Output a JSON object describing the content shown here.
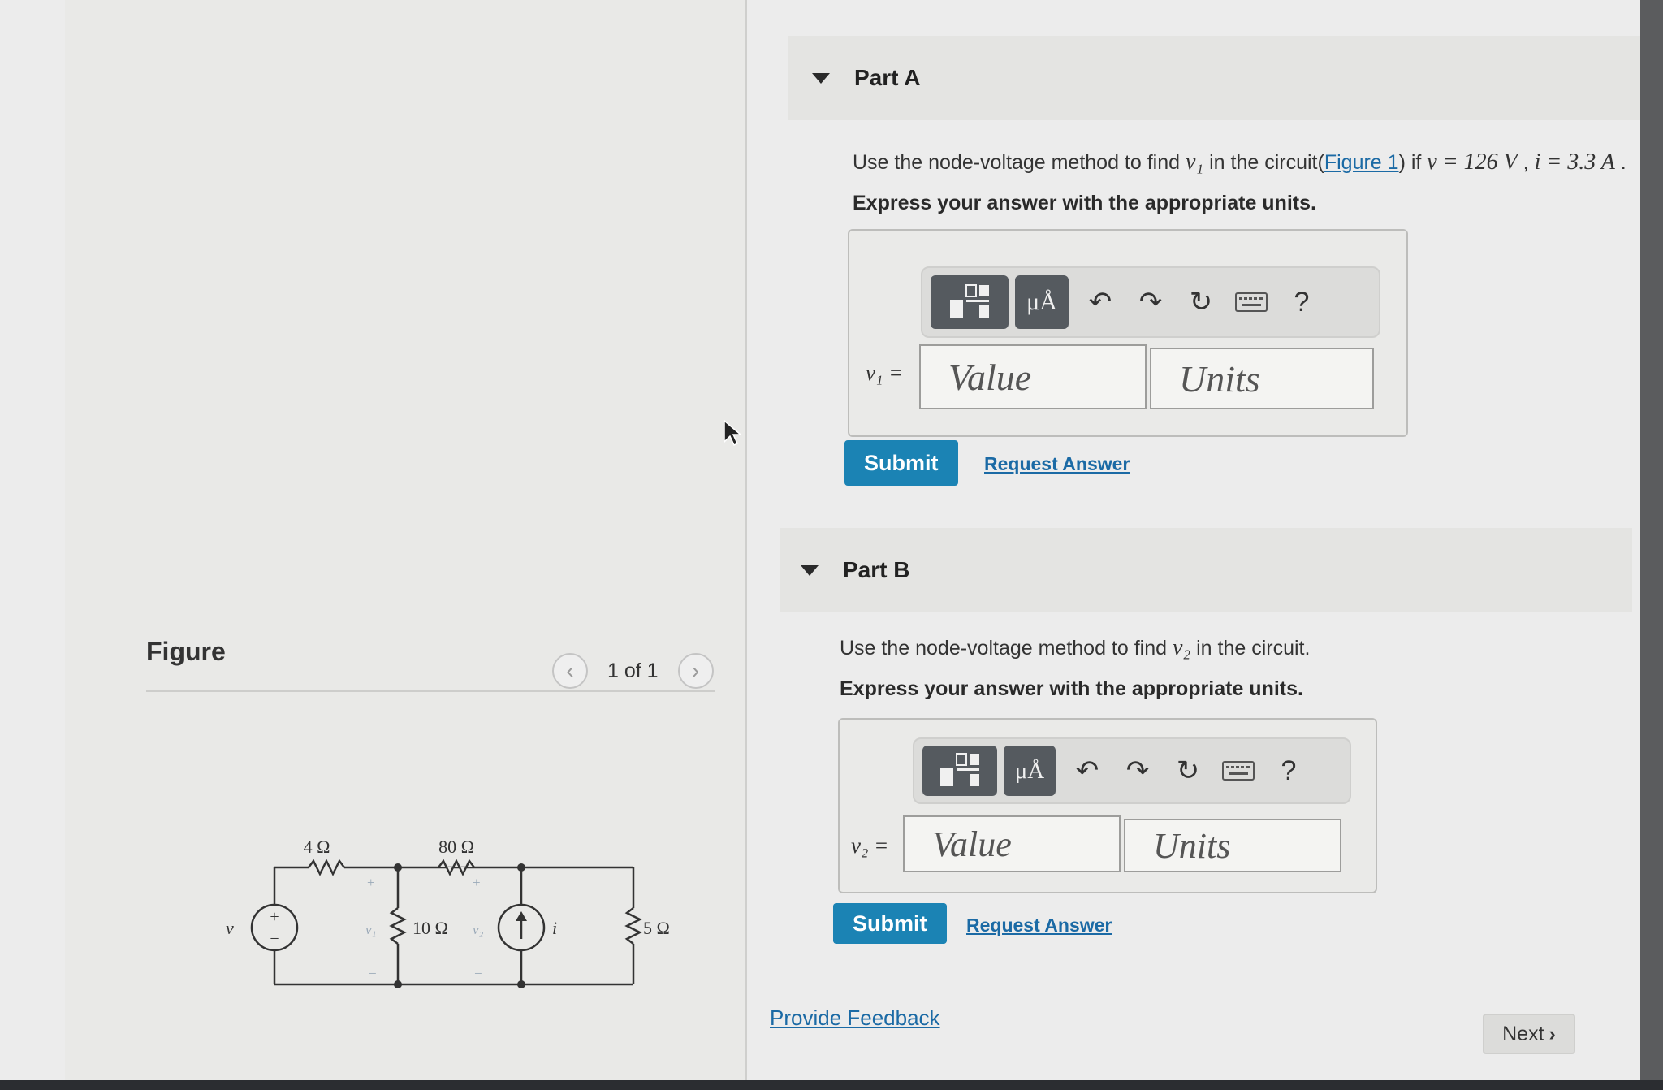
{
  "figure": {
    "title": "Figure",
    "pager": "1 of 1",
    "prev_icon": "chevron-left-icon",
    "next_icon": "chevron-right-icon",
    "circuit": {
      "r1": "4 Ω",
      "r2": "80 Ω",
      "r3": "10 Ω",
      "r4": "5 Ω",
      "source_v": "v",
      "source_i": "i",
      "node1": "v₁",
      "node2": "v₂",
      "plus": "+",
      "minus": "−"
    }
  },
  "part_a": {
    "title": "Part A",
    "prompt_pre": "Use the node-voltage method to find ",
    "prompt_var": "v₁",
    "prompt_mid": " in the circuit(",
    "prompt_link": "Figure 1",
    "prompt_post1": ") if ",
    "prompt_v": "v = 126 V",
    "prompt_sep": " , ",
    "prompt_i": "i = 3.3 A",
    "prompt_end": " .",
    "instruction": "Express your answer with the appropriate units.",
    "var_label": "v₁ =",
    "value_placeholder": "Value",
    "units_placeholder": "Units",
    "submit": "Submit",
    "request": "Request Answer"
  },
  "part_b": {
    "title": "Part B",
    "prompt_pre": "Use the node-voltage method to find ",
    "prompt_var": "v₂",
    "prompt_post": " in the circuit.",
    "instruction": "Express your answer with the appropriate units.",
    "var_label": "v₂ =",
    "value_placeholder": "Value",
    "units_placeholder": "Units",
    "submit": "Submit",
    "request": "Request Answer"
  },
  "toolbar": {
    "units_label": "μÅ",
    "help": "?",
    "icons": [
      "templates-icon",
      "units-icon",
      "undo-icon",
      "redo-icon",
      "reset-icon",
      "keyboard-icon",
      "help-icon"
    ]
  },
  "footer": {
    "feedback": "Provide Feedback",
    "next": "Next",
    "next_icon": "chevron-right-icon"
  },
  "colors": {
    "accent": "#1b83b4",
    "link": "#1b6aa5",
    "toolbar_dark": "#555a5f"
  }
}
